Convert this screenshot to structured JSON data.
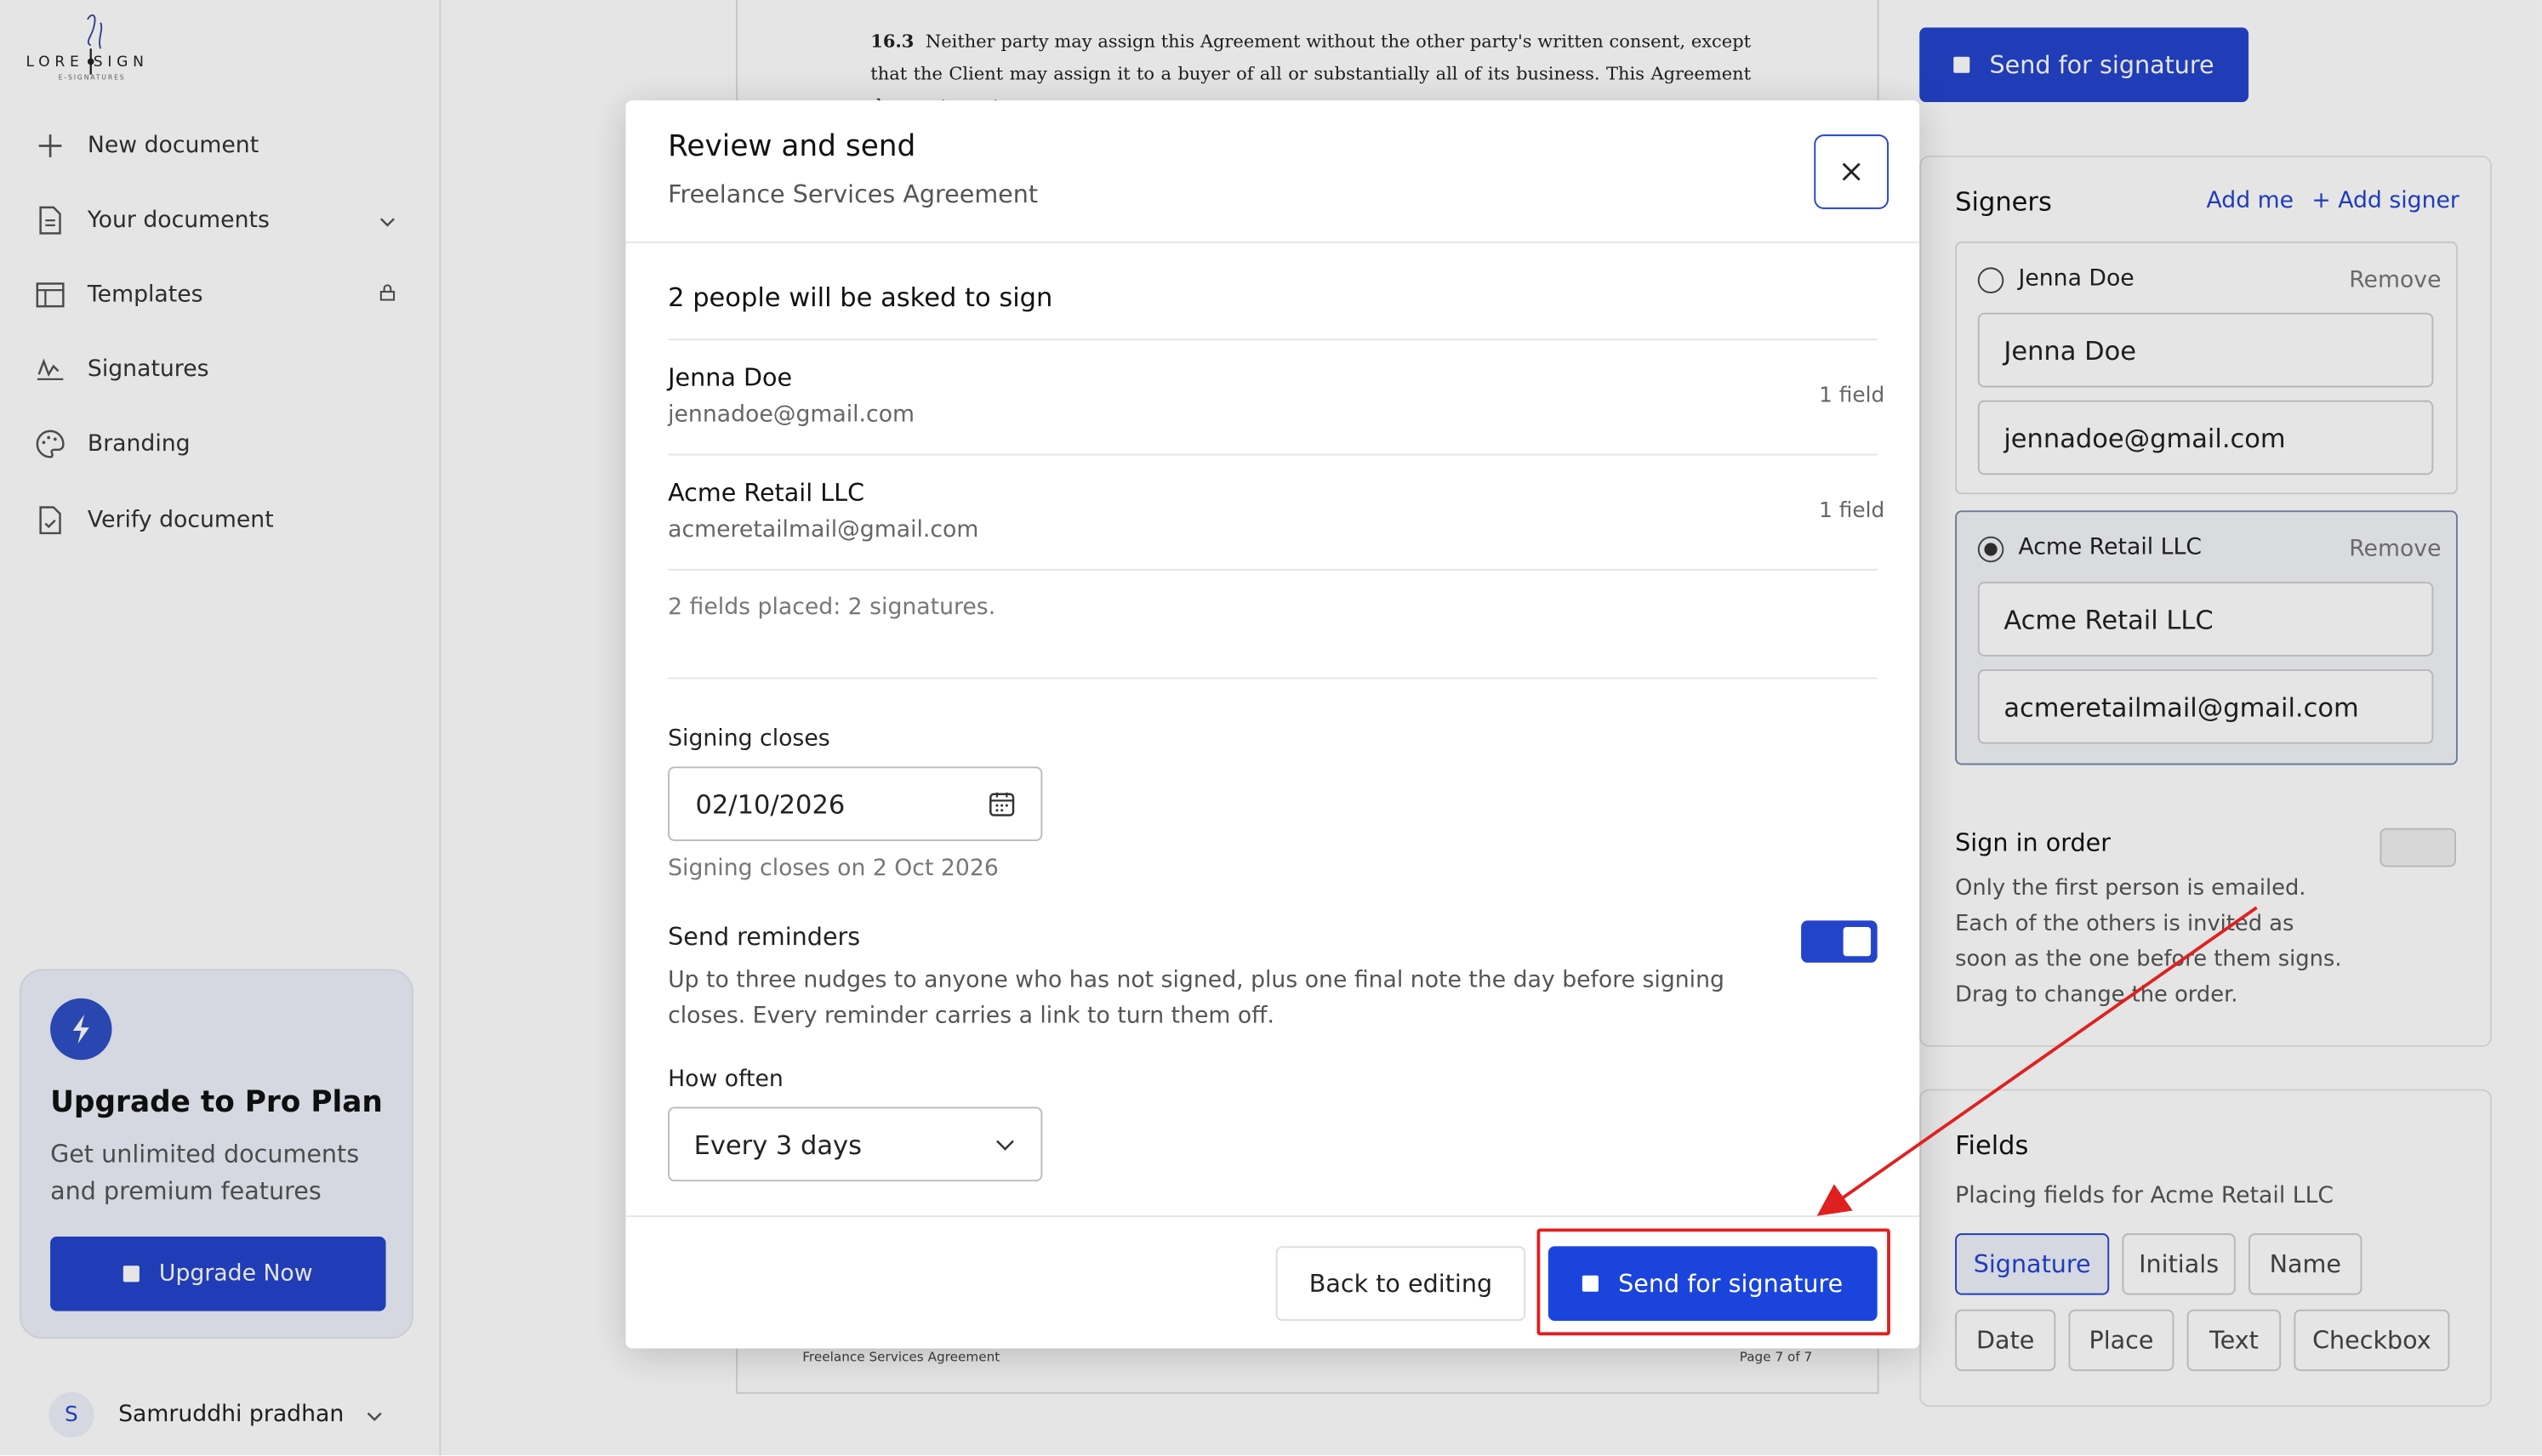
{
  "sidebar": {
    "logo_letters": "LORE SIGN",
    "logo_sub": "E-SIGNATURES",
    "items": [
      {
        "label": "New document",
        "icon": "plus-icon"
      },
      {
        "label": "Your documents",
        "icon": "document-icon"
      },
      {
        "label": "Templates",
        "icon": "template-icon"
      },
      {
        "label": "Signatures",
        "icon": "signature-icon"
      },
      {
        "label": "Branding",
        "icon": "palette-icon"
      },
      {
        "label": "Verify document",
        "icon": "verify-document-icon"
      }
    ],
    "upgrade": {
      "title": "Upgrade to Pro Plan",
      "subtitle": "Get unlimited documents and premium features",
      "button": "Upgrade Now"
    },
    "user": {
      "initial": "S",
      "name": "Samruddhi pradhan"
    }
  },
  "document": {
    "clause_number": "16.3",
    "clause_text": "Neither party may assign this Agreement without the other party's written consent, except that the Client may assign it to a buyer of all or substantially all of its business. This Agreement does not create a",
    "footer_left": "Freelance Services Agreement",
    "footer_right": "Page 7 of 7"
  },
  "right_panel": {
    "send_button": "Send for signature",
    "signers_title": "Signers",
    "add_me": "Add me",
    "add_signer": "+ Add signer",
    "remove_label": "Remove",
    "signers": [
      {
        "name": "Jenna Doe",
        "email": "jennadoe@gmail.com"
      },
      {
        "name": "Acme Retail LLC",
        "email": "acmeretailmail@gmail.com"
      }
    ],
    "sign_in_order": "Sign in order",
    "order_description": "Only the first person is emailed. Each of the others is invited as soon as the one before them signs. Drag to change the order.",
    "fields_title": "Fields",
    "fields_subtitle": "Placing fields for Acme Retail LLC",
    "field_types": [
      "Signature",
      "Initials",
      "Name",
      "Date",
      "Place",
      "Text",
      "Checkbox"
    ]
  },
  "modal": {
    "title": "Review and send",
    "subtitle": "Freelance Services Agreement",
    "heading": "2 people will be asked to sign",
    "people": [
      {
        "name": "Jenna Doe",
        "email": "jennadoe@gmail.com",
        "fields": "1 field"
      },
      {
        "name": "Acme Retail LLC",
        "email": "acmeretailmail@gmail.com",
        "fields": "1 field"
      }
    ],
    "placed_summary": "2 fields placed: 2 signatures.",
    "signing_closes_label": "Signing closes",
    "signing_closes_value": "02/10/2026",
    "signing_closes_hint": "Signing closes on 2 Oct 2026",
    "send_reminders_label": "Send reminders",
    "send_reminders_text": "Up to three nudges to anyone who has not signed, plus one final note the day before signing closes. Every reminder carries a link to turn them off.",
    "how_often_label": "How often",
    "how_often_value": "Every 3 days",
    "back_button": "Back to editing",
    "send_button": "Send for signature"
  },
  "colors": {
    "accent": "#2444cc",
    "annotation": "#e02020"
  }
}
